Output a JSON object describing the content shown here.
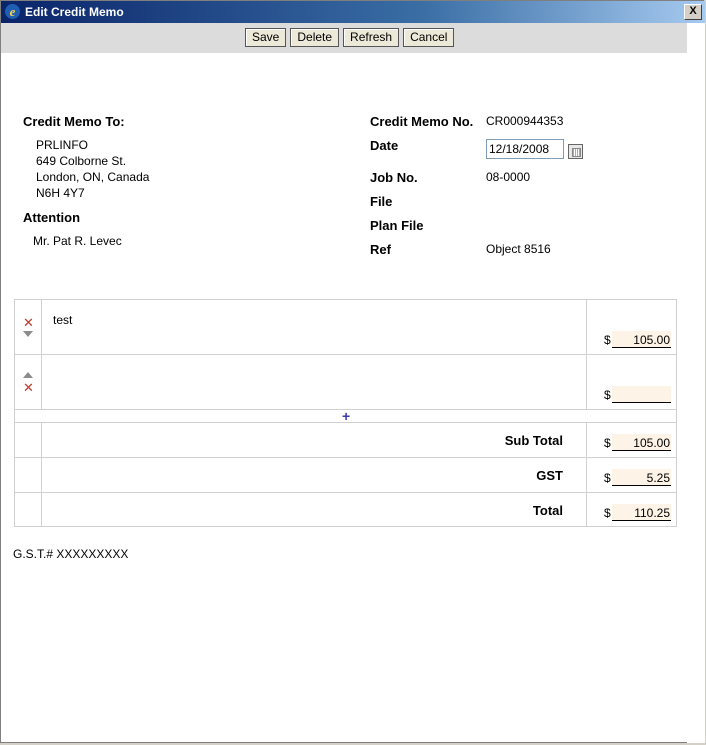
{
  "window": {
    "title": "Edit Credit Memo",
    "close_label": "X"
  },
  "toolbar": {
    "save": "Save",
    "delete": "Delete",
    "refresh": "Refresh",
    "cancel": "Cancel"
  },
  "billto": {
    "heading": "Credit Memo To:",
    "lines": [
      "PRLINFO",
      "649 Colborne St.",
      "London, ON, Canada",
      "N6H 4Y7"
    ],
    "attention_label": "Attention",
    "attention_value": "Mr. Pat R. Levec"
  },
  "details": {
    "memo_no_label": "Credit Memo No.",
    "memo_no_value": "CR000944353",
    "date_label": "Date",
    "date_value": "12/18/2008",
    "job_label": "Job No.",
    "job_value": "08-0000",
    "file_label": "File",
    "plan_file_label": "Plan File",
    "ref_label": "Ref",
    "ref_value": "Object 8516"
  },
  "items": [
    {
      "description": "test",
      "currency": "$",
      "amount": "105.00"
    },
    {
      "description": "",
      "currency": "$",
      "amount": ""
    }
  ],
  "totals": {
    "subtotal_label": "Sub Total",
    "subtotal_value": "105.00",
    "gst_label": "GST",
    "gst_value": "5.25",
    "total_label": "Total",
    "total_value": "110.25",
    "currency": "$"
  },
  "footer": {
    "gst_number": "G.S.T.# XXXXXXXXX"
  },
  "icons": {
    "delete": "delete-x-icon",
    "move_down": "arrow-down-icon",
    "move_up": "arrow-up-icon",
    "add": "plus-icon",
    "calendar": "calendar-icon"
  }
}
